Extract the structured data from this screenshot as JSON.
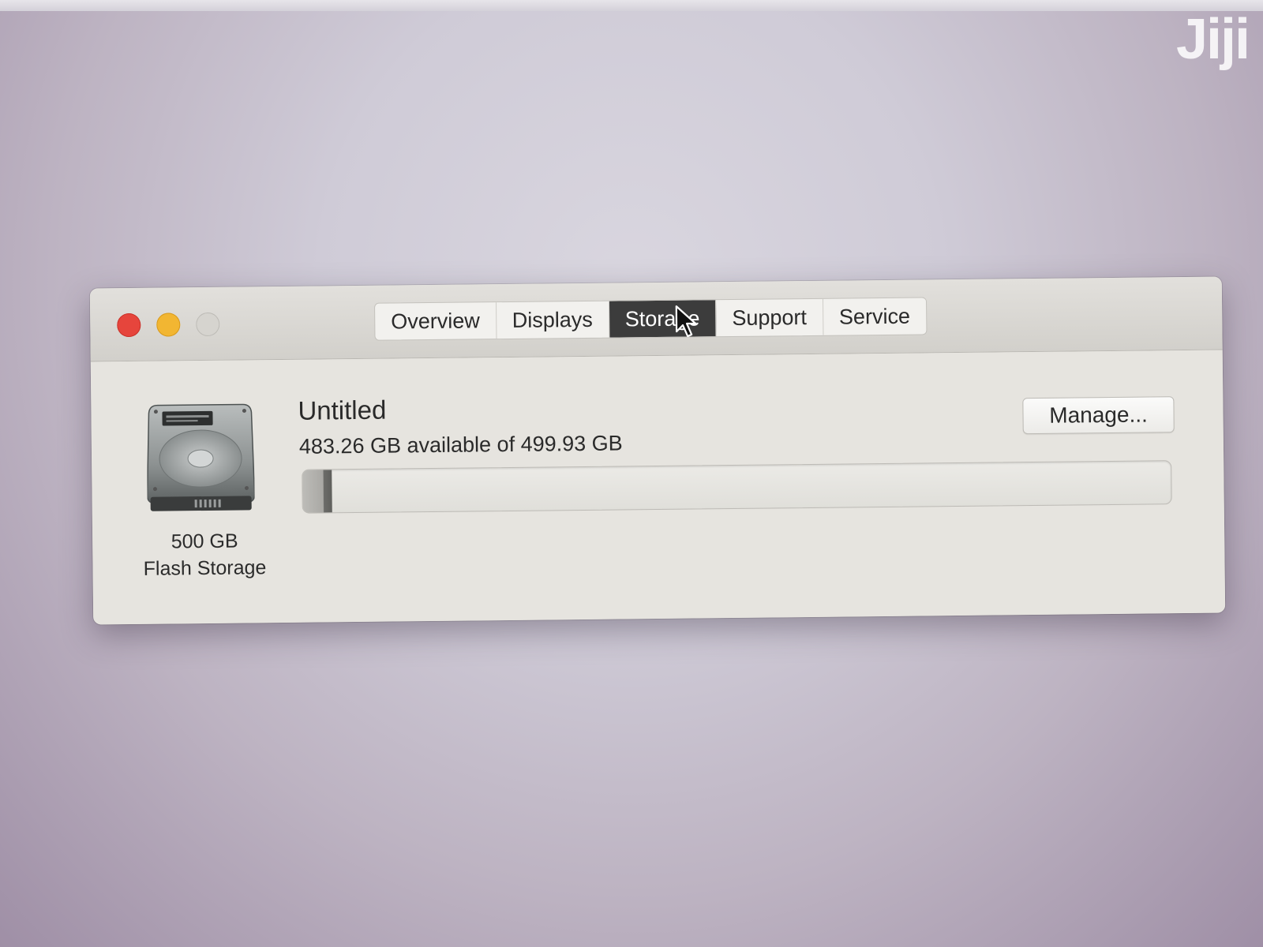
{
  "watermark": "Jiji",
  "window": {
    "traffic_lights": {
      "close": "#e6453c",
      "minimize": "#f2b632",
      "zoom": "#d6d4cf"
    },
    "tabs": [
      {
        "label": "Overview",
        "selected": false
      },
      {
        "label": "Displays",
        "selected": false
      },
      {
        "label": "Storage",
        "selected": true
      },
      {
        "label": "Support",
        "selected": false
      },
      {
        "label": "Service",
        "selected": false
      }
    ]
  },
  "storage": {
    "disk_icon": "hard-drive-icon",
    "disk_size": "500 GB",
    "disk_type": "Flash Storage",
    "volume_name": "Untitled",
    "usage_text": "483.26 GB available of 499.93 GB",
    "available_gb": 483.26,
    "total_gb": 499.93,
    "used_fraction": 0.0333,
    "manage_label": "Manage..."
  },
  "cursor": "arrow-cursor-icon"
}
